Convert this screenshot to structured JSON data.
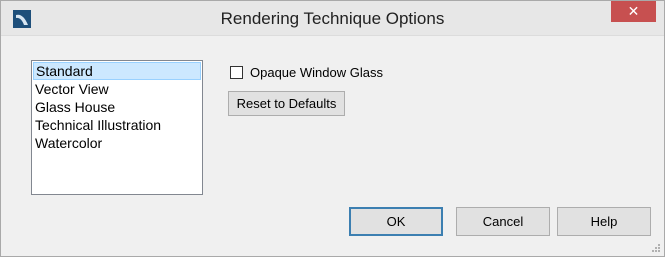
{
  "window": {
    "title": "Rendering Technique Options",
    "close_label": "✕"
  },
  "techniques": {
    "items": [
      "Standard",
      "Vector View",
      "Glass House",
      "Technical Illustration",
      "Watercolor"
    ],
    "selected": "Standard"
  },
  "options": {
    "opaque_window_glass_label": "Opaque Window Glass",
    "opaque_window_glass_checked": false,
    "reset_label": "Reset to Defaults"
  },
  "footer": {
    "ok_label": "OK",
    "cancel_label": "Cancel",
    "help_label": "Help"
  },
  "colors": {
    "selection_bg": "#cce8ff",
    "close_button": "#c75050",
    "app_icon": "#1e4f7a"
  }
}
